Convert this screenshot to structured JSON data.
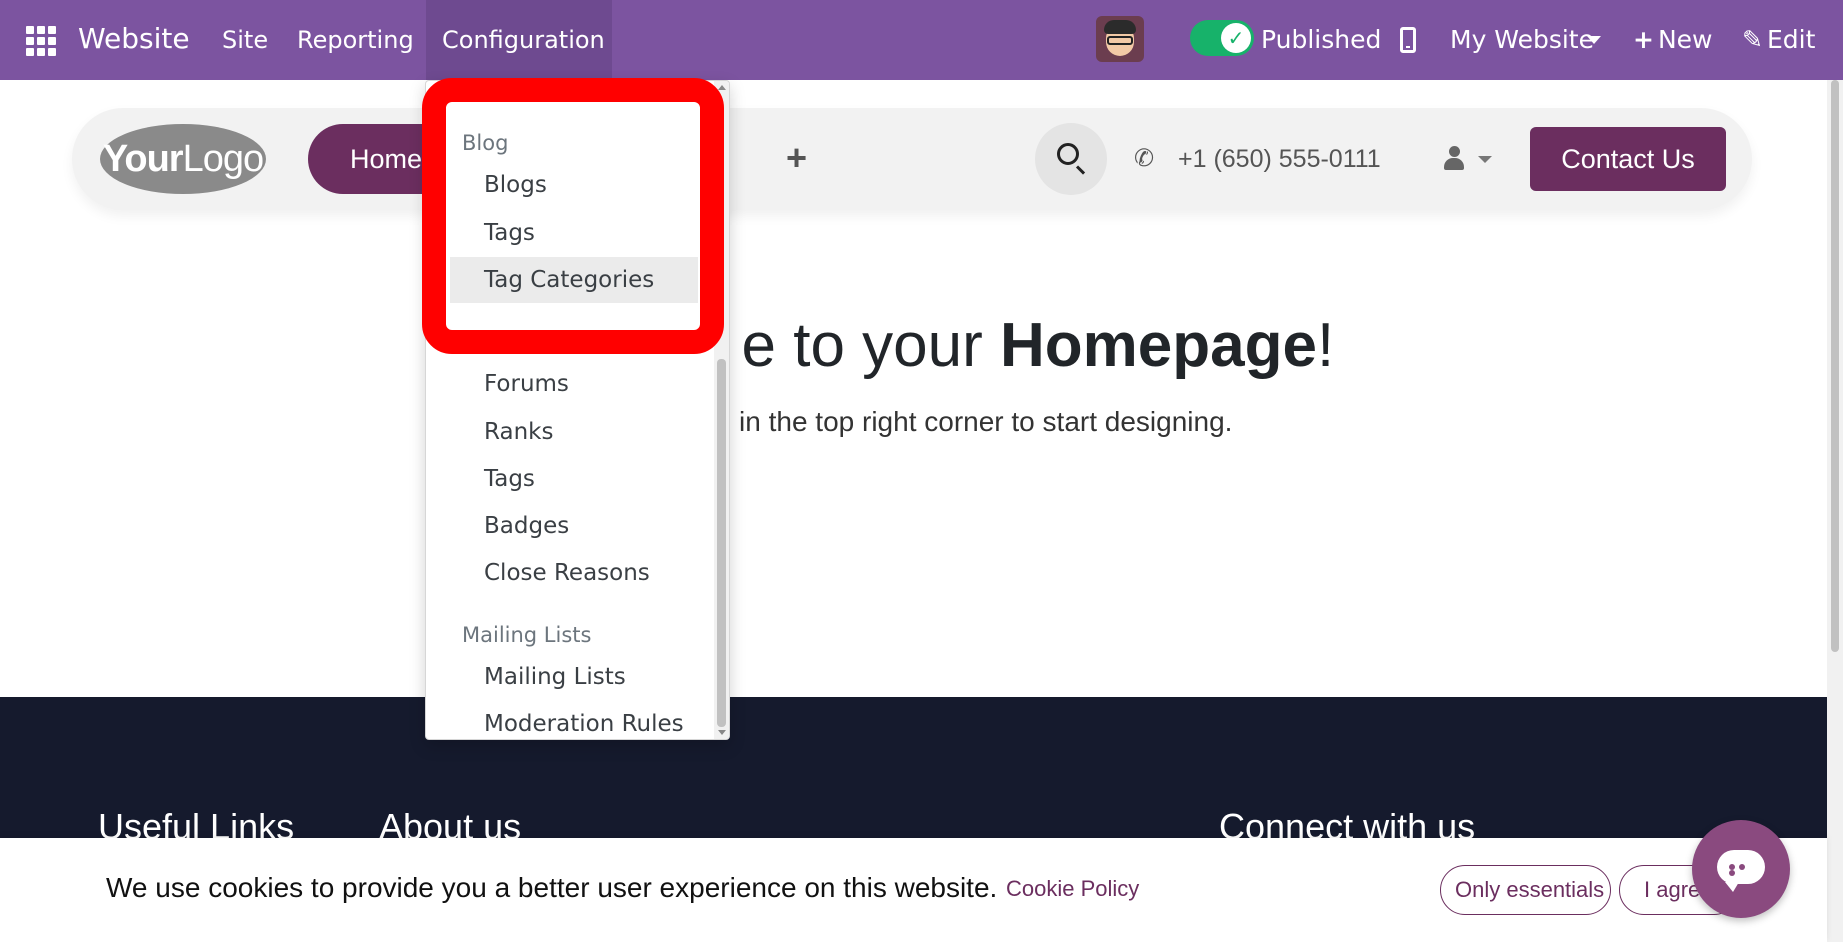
{
  "topbar": {
    "app_name": "Website",
    "menu": [
      "Site",
      "Reporting",
      "Configuration"
    ],
    "published_label": "Published",
    "website_selector": "My Website",
    "new_label": "New",
    "edit_label": "Edit",
    "publish_toggle_on": true
  },
  "header": {
    "logo_text_bold": "Your",
    "logo_text_light": "Logo",
    "home_label": "Home",
    "add_label": "+",
    "phone": "+1 (650) 555-0111",
    "contact_label": "Contact Us"
  },
  "hero": {
    "title_part": "e to your ",
    "title_bold": "Homepage",
    "title_end": "!",
    "subtitle": "in the top right corner to start designing."
  },
  "dropdown": {
    "sections": [
      {
        "header": "Blog",
        "items": [
          "Blogs",
          "Tags",
          "Tag Categories"
        ],
        "active_item": "Tag Categories"
      },
      {
        "header": "",
        "items": [
          "Forums",
          "Ranks",
          "Tags",
          "Badges",
          "Close Reasons"
        ]
      },
      {
        "header": "Mailing Lists",
        "items": [
          "Mailing Lists",
          "Moderation Rules"
        ]
      }
    ]
  },
  "footer": {
    "columns": [
      "Useful Links",
      "About us",
      "Connect with us"
    ]
  },
  "cookie": {
    "message": "We use cookies to provide you a better user experience on this website.",
    "policy_link": "Cookie Policy",
    "only_essentials": "Only essentials",
    "agree": "I agree"
  },
  "colors": {
    "topbar": "#7c54a0",
    "brand": "#6b2e5f",
    "footer": "#151a2d",
    "highlight": "#ff0000",
    "toggle": "#17b26a"
  },
  "icons": {
    "apps": "apps-grid-icon",
    "toggle_check": "check-icon",
    "mobile": "mobile-icon",
    "caret": "caret-down-icon",
    "search": "search-icon",
    "phone": "phone-icon",
    "user": "user-icon",
    "chat": "chat-icon"
  }
}
